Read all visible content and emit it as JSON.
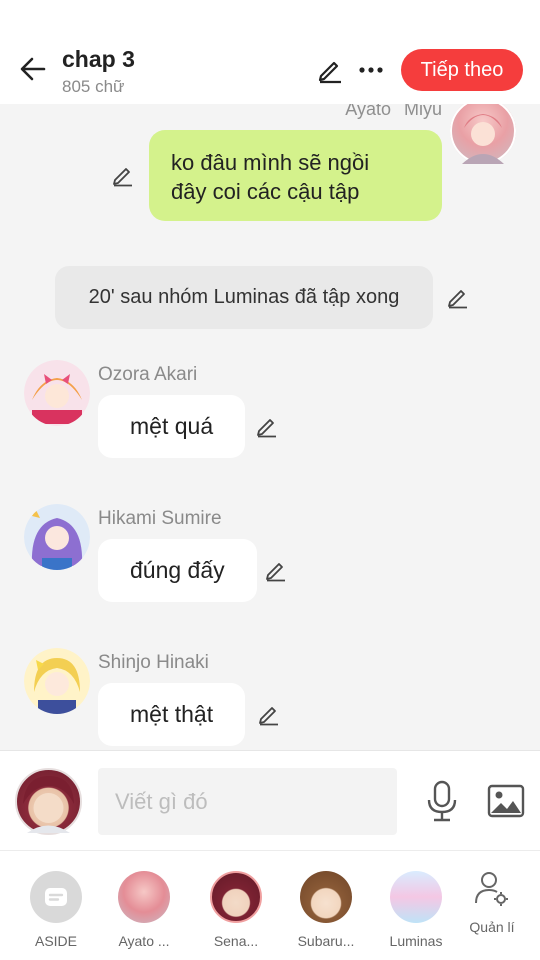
{
  "header": {
    "title": "chap 3",
    "subtitle": "805 chữ",
    "next_label": "Tiếp theo"
  },
  "chat": {
    "right_names": "Ayato  Miyu",
    "messages": [
      {
        "type": "outgoing",
        "text_line1": "ko đâu mình sẽ ngồi",
        "text_line2": "đây coi các cậu tập"
      },
      {
        "type": "narration",
        "text": "20' sau nhóm Luminas đã tập xong"
      },
      {
        "type": "incoming",
        "name": "Ozora Akari",
        "text": "mệt quá"
      },
      {
        "type": "incoming",
        "name": "Hikami Sumire",
        "text": "đúng đấy"
      },
      {
        "type": "incoming",
        "name": "Shinjo Hinaki",
        "text": "mệt thật"
      }
    ]
  },
  "input": {
    "placeholder": "Viết gì đó"
  },
  "characters": [
    {
      "label": "ASIDE",
      "icon": "aside-icon"
    },
    {
      "label": "Ayato ...",
      "icon": "avatar"
    },
    {
      "label": "Sena...",
      "icon": "avatar"
    },
    {
      "label": "Subaru...",
      "icon": "avatar"
    },
    {
      "label": "Luminas",
      "icon": "avatar"
    },
    {
      "label": "Quản lí",
      "icon": "manage-user-icon"
    }
  ],
  "colors": {
    "accent": "#f53d3d",
    "outgoing_bubble": "#d4f28c",
    "chat_background": "#f4f4f4",
    "narration_bubble": "#e9e9e9"
  }
}
